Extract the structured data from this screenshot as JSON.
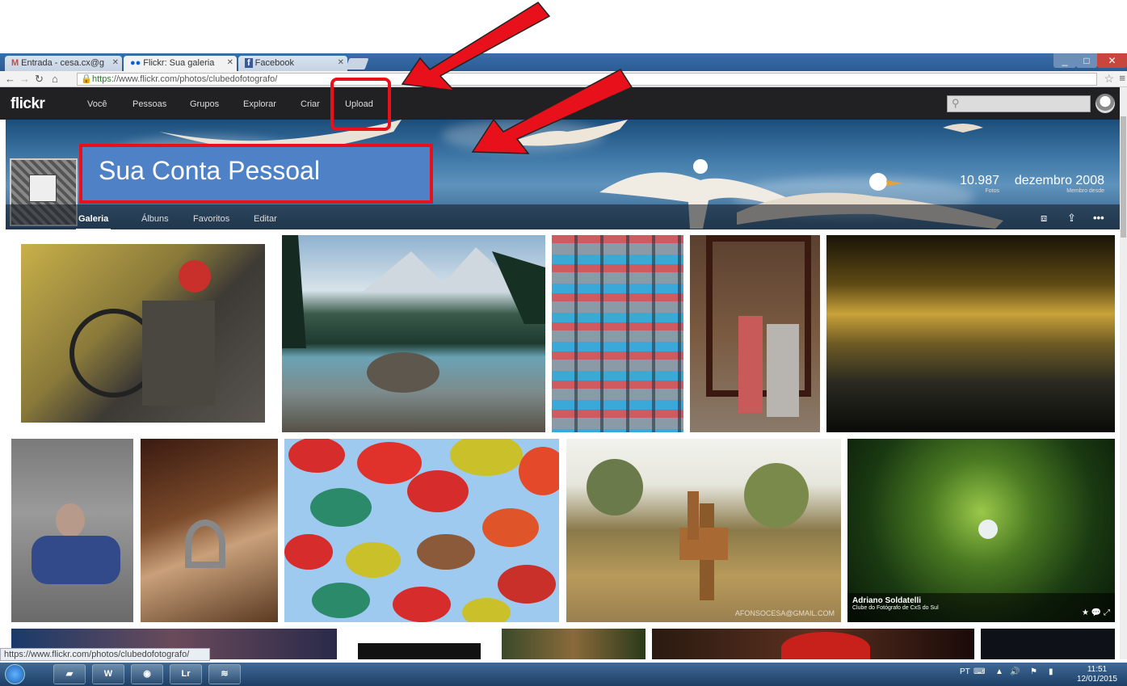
{
  "browser": {
    "tabs": [
      {
        "label": "Entrada - cesa.cx@g",
        "favicon": "M",
        "color": "#d44638"
      },
      {
        "label": "Flickr: Sua galeria",
        "favicon": "●●",
        "color": "#0063dc"
      },
      {
        "label": "Facebook",
        "favicon": "f",
        "color": "#3b5998"
      }
    ],
    "url_scheme": "https",
    "url_rest": "://www.flickr.com/photos/clubedofotografo/",
    "status_url": "https://www.flickr.com/photos/clubedofotografo/"
  },
  "flickr": {
    "logo": "flickr",
    "nav": [
      "Você",
      "Pessoas",
      "Grupos",
      "Explorar",
      "Criar",
      "Upload"
    ],
    "search_placeholder": ""
  },
  "profile": {
    "subnav": [
      "Galeria",
      "Álbuns",
      "Favoritos",
      "Editar"
    ],
    "photo_count": "10.987",
    "photo_count_label": "Fotos",
    "member_since": "dezembro 2008",
    "member_since_label": "Membro desde"
  },
  "annotation": {
    "label": "Sua Conta Pessoal",
    "color": "#e8101a",
    "box_color": "#4f81c7"
  },
  "gallery": {
    "featured_caption_name": "Adriano Soldatelli",
    "featured_caption_group": "Clube do Fotógrafo de CxS do Sul",
    "featured_actions": "★ 💬 ⤢",
    "watermark": "AFONSOCESA@GMAIL.COM"
  },
  "taskbar": {
    "lang": "PT",
    "time": "11:51",
    "date": "12/01/2015",
    "apps": [
      "folder",
      "W",
      "chrome",
      "Lr",
      "spotify"
    ]
  }
}
